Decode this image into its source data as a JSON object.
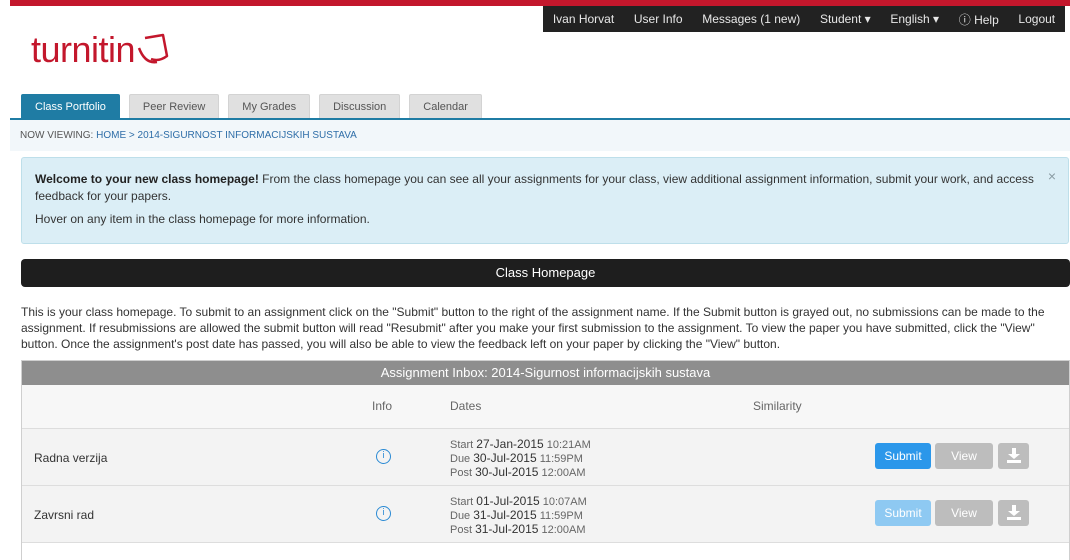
{
  "topnav": {
    "user": "Ivan Horvat",
    "user_info": "User Info",
    "messages": "Messages (1 new)",
    "role": "Student ▾",
    "language": "English ▾",
    "help": "ⓘ Help",
    "logout": "Logout"
  },
  "logo": {
    "text": "turnitin"
  },
  "tabs": [
    "Class Portfolio",
    "Peer Review",
    "My Grades",
    "Discussion",
    "Calendar"
  ],
  "breadcrumb": {
    "prefix": "NOW VIEWING:",
    "home": "HOME",
    "sep": ">",
    "current": "2014-SIGURNOST INFORMACIJSKIH SUSTAVA"
  },
  "welcome": {
    "bold": "Welcome to your new class homepage!",
    "text": " From the class homepage you can see all your assignments for your class, view additional assignment information, submit your work, and access feedback for your papers.",
    "hover": "Hover on any item in the class homepage for more information.",
    "close": "×"
  },
  "class_bar": "Class Homepage",
  "intro": "This is your class homepage. To submit to an assignment click on the \"Submit\" button to the right of the assignment name. If the Submit button is grayed out, no submissions can be made to the assignment. If resubmissions are allowed the submit button will read \"Resubmit\" after you make your first submission to the assignment. To view the paper you have submitted, click the \"View\" button. Once the assignment's post date has passed, you will also be able to view the feedback left on your paper by clicking the \"View\" button.",
  "inbox": {
    "title": "Assignment Inbox: 2014-Sigurnost informacijskih sustava",
    "columns": {
      "info": "Info",
      "dates": "Dates",
      "similarity": "Similarity"
    },
    "rows": [
      {
        "name": "Radna verzija",
        "start_label": "Start",
        "start_date": "27-Jan-2015",
        "start_time": "10:21AM",
        "due_label": "Due",
        "due_date": "30-Jul-2015",
        "due_time": "11:59PM",
        "post_label": "Post",
        "post_date": "30-Jul-2015",
        "post_time": "12:00AM",
        "submit": "Submit",
        "view": "View"
      },
      {
        "name": "Zavrsni rad",
        "start_label": "Start",
        "start_date": "01-Jul-2015",
        "start_time": "10:07AM",
        "due_label": "Due",
        "due_date": "31-Jul-2015",
        "due_time": "11:59PM",
        "post_label": "Post",
        "post_date": "31-Jul-2015",
        "post_time": "12:00AM",
        "submit": "Submit",
        "view": "View"
      }
    ]
  },
  "colors": {
    "brand_red": "#c3172c",
    "tab_active": "#1f7ca4",
    "submit_blue": "#2b97ea"
  }
}
